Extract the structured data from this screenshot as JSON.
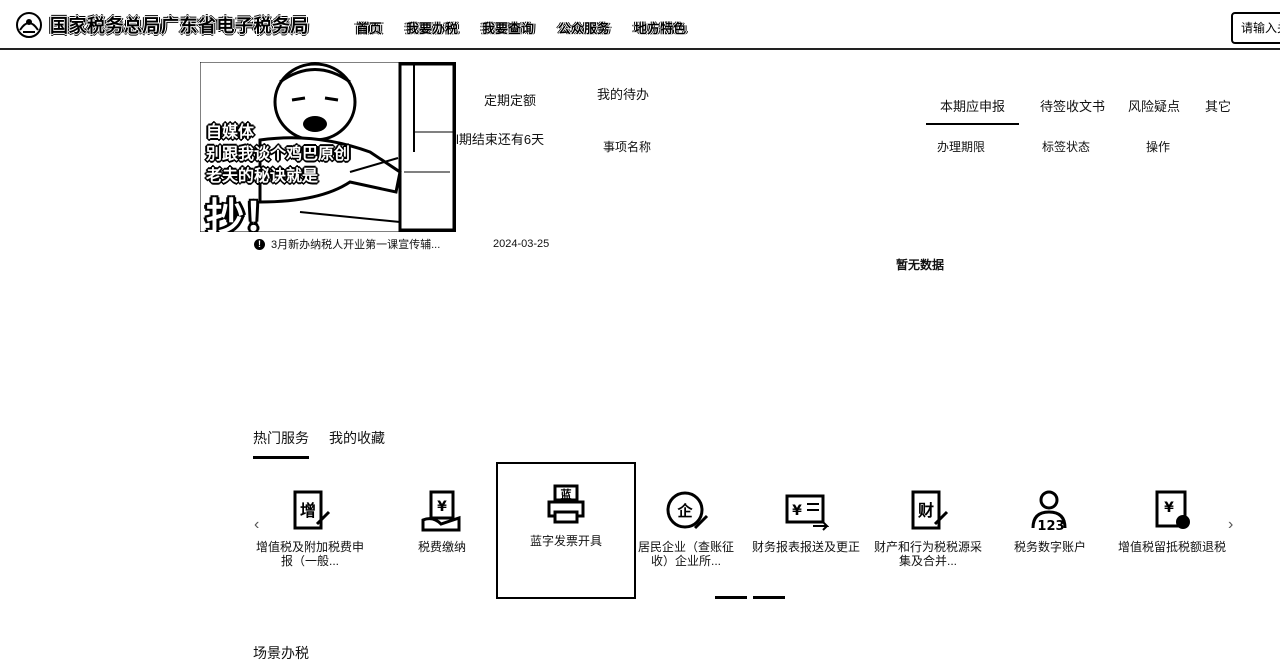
{
  "header": {
    "logo_text": "国家税务总局广东省电子税务局",
    "nav": [
      "首页",
      "我要办税",
      "我要查询",
      "公众服务",
      "地方特色"
    ],
    "search_placeholder": "请输入关"
  },
  "banner": {
    "line1": "自媒体",
    "line2": "别跟我谈个鸡巴原创",
    "line3": "老夫的秘诀就是",
    "big": "抄！"
  },
  "notice": {
    "icon": "!",
    "text": "3月新办纳税人开业第一课宣传辅...",
    "date": "2024-03-25"
  },
  "deadline": {
    "title": "定期定额",
    "text": "l期结束还有6天"
  },
  "todo": {
    "title": "我的待办",
    "col_name": "事项名称",
    "col_deadline": "办理期限",
    "col_sign": "标签状态",
    "col_action": "操作",
    "tabs": [
      "本期应申报",
      "待签收文书",
      "风险疑点",
      "其它"
    ],
    "empty": "暂无数据"
  },
  "services": {
    "tabs": [
      "热门服务",
      "我的收藏"
    ],
    "prev": "‹",
    "next": "›",
    "items": [
      {
        "label": "增值税及附加税费申报（一般...",
        "icon": "increase-tax-icon",
        "glyph": "增"
      },
      {
        "label": "税费缴纳",
        "icon": "tax-payment-icon",
        "glyph": "¥"
      },
      {
        "label": "蓝字发票开具",
        "icon": "invoice-printer-icon",
        "glyph": "蓝"
      },
      {
        "label": "居民企业（查账征收）企业所...",
        "icon": "enterprise-icon",
        "glyph": "企"
      },
      {
        "label": "财务报表报送及更正",
        "icon": "financial-report-icon",
        "glyph": "¥"
      },
      {
        "label": "财产和行为税税源采集及合并...",
        "icon": "property-tax-icon",
        "glyph": "财"
      },
      {
        "label": "税务数字账户",
        "icon": "digital-account-icon",
        "glyph": "123"
      },
      {
        "label": "增值税留抵税额退税",
        "icon": "vat-refund-icon",
        "glyph": "¥"
      }
    ]
  },
  "scene": {
    "title": "场景办税"
  }
}
